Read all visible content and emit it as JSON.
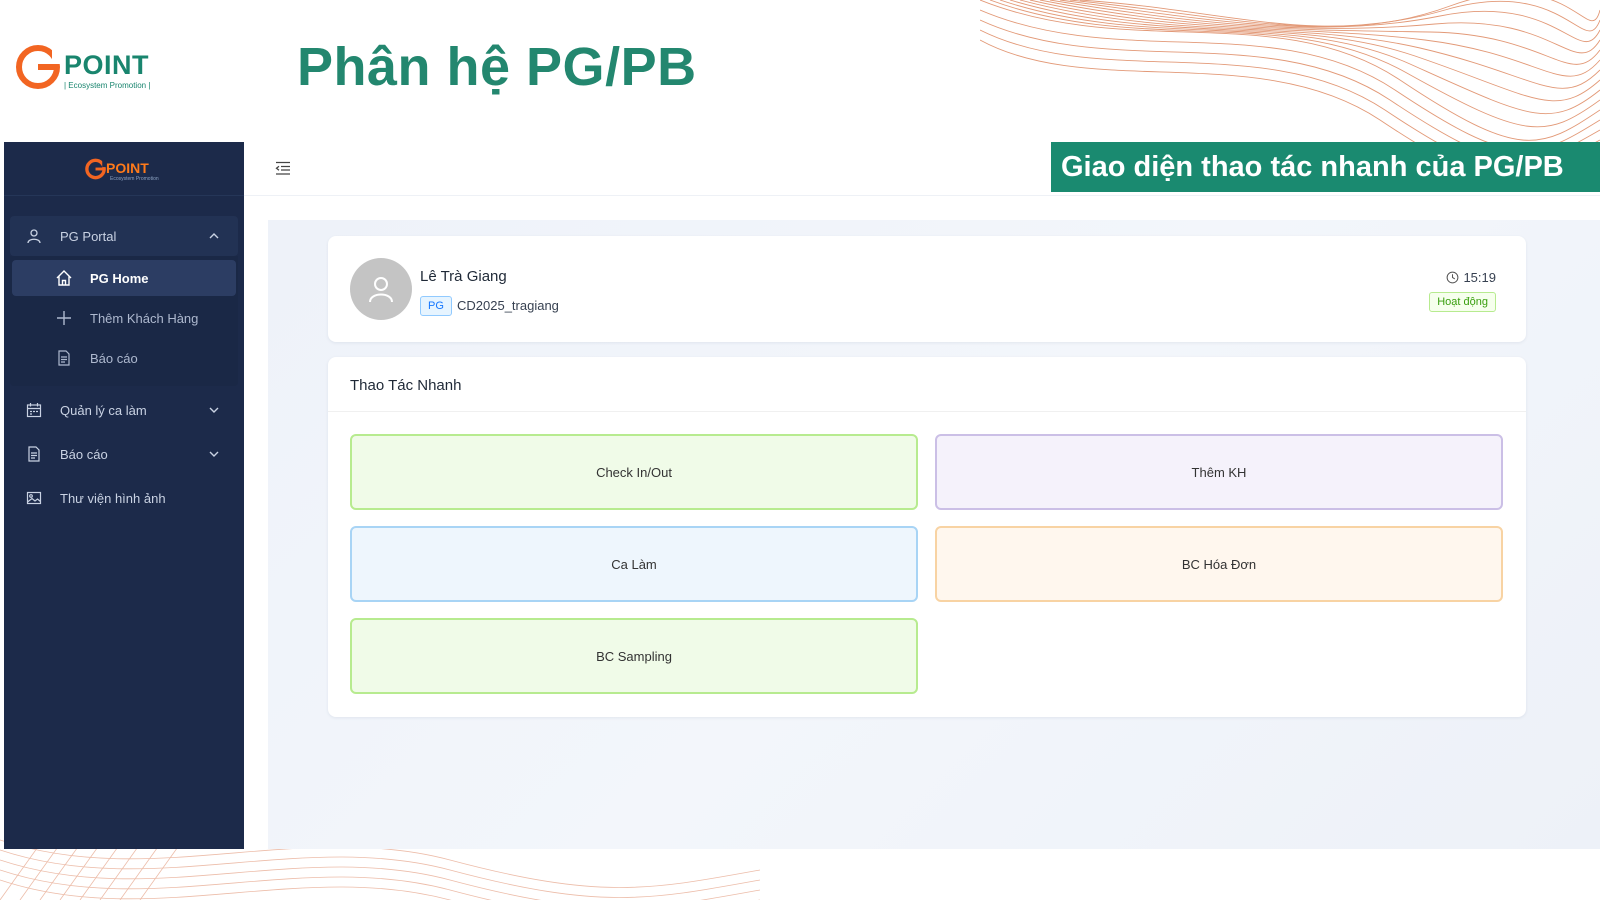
{
  "brand": {
    "logo_text": "POINT",
    "logo_sub": "| Ecosystem Promotion |",
    "primary_color": "#1a8a70",
    "accent_color": "#f26522"
  },
  "slide": {
    "title": "Phân hệ PG/PB",
    "banner": "Giao diện thao tác nhanh của PG/PB"
  },
  "sidebar": {
    "logo_text": "POINT",
    "logo_sub": "Ecosystem Promotion",
    "groups": [
      {
        "label": "PG Portal",
        "icon": "user-icon",
        "expanded": true
      },
      {
        "label": "Quản lý ca làm",
        "icon": "calendar-icon",
        "expanded": false
      },
      {
        "label": "Báo cáo",
        "icon": "document-icon",
        "expanded": false
      },
      {
        "label": "Thư viện hình ảnh",
        "icon": "image-icon"
      }
    ],
    "pg_portal_items": [
      {
        "label": "PG Home",
        "icon": "home-icon",
        "active": true
      },
      {
        "label": "Thêm Khách Hàng",
        "icon": "plus-icon"
      },
      {
        "label": "Báo cáo",
        "icon": "document-icon"
      }
    ]
  },
  "topbar": {
    "menu_icon": "menu-fold-icon"
  },
  "profile": {
    "name": "Lê Trà Giang",
    "role": "PG",
    "code": "CD2025_tragiang",
    "time": "15:19",
    "status": "Hoạt động"
  },
  "quick_actions": {
    "title": "Thao Tác Nhanh",
    "items": [
      {
        "label": "Check In/Out",
        "bg": "#f0fbe8",
        "border": "#b7eb8f"
      },
      {
        "label": "Thêm KH",
        "bg": "#f5f2fb",
        "border": "#cbbfe6"
      },
      {
        "label": "Ca Làm",
        "bg": "#eef6fd",
        "border": "#a8d4f5"
      },
      {
        "label": "BC Hóa Đơn",
        "bg": "#fff7ee",
        "border": "#f8d3a3"
      },
      {
        "label": "BC Sampling",
        "bg": "#f0fbe8",
        "border": "#b7eb8f"
      }
    ]
  }
}
